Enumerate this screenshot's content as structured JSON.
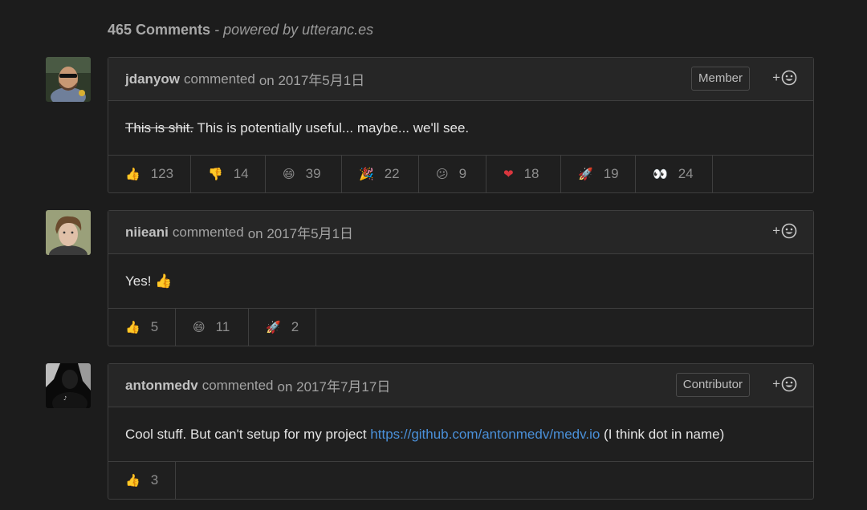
{
  "header": {
    "count_label": "465 Comments",
    "powered_label": "- powered by utteranc.es"
  },
  "comments": [
    {
      "author": "jdanyow",
      "verb": "commented",
      "date": "on 2017年5月1日",
      "badge": "Member",
      "body_strike": "This is shit.",
      "body_text": " This is potentially useful... maybe... we'll see.",
      "reactions": [
        {
          "icon": "thumbs-up-icon",
          "emoji": "👍",
          "count": "123"
        },
        {
          "icon": "thumbs-down-icon",
          "emoji": "👎",
          "count": "14"
        },
        {
          "icon": "laugh-icon",
          "emoji": "😄",
          "count": "39"
        },
        {
          "icon": "hooray-icon",
          "emoji": "🎉",
          "count": "22"
        },
        {
          "icon": "confused-icon",
          "emoji": "😕",
          "count": "9"
        },
        {
          "icon": "heart-icon",
          "emoji": "❤",
          "count": "18"
        },
        {
          "icon": "rocket-icon",
          "emoji": "🚀",
          "count": "19"
        },
        {
          "icon": "eyes-icon",
          "emoji": "👀",
          "count": "24"
        }
      ]
    },
    {
      "author": "niieani",
      "verb": "commented",
      "date": "on 2017年5月1日",
      "body_text": "Yes! 👍",
      "reactions": [
        {
          "icon": "thumbs-up-icon",
          "emoji": "👍",
          "count": "5"
        },
        {
          "icon": "laugh-icon",
          "emoji": "😄",
          "count": "11"
        },
        {
          "icon": "rocket-icon",
          "emoji": "🚀",
          "count": "2"
        }
      ]
    },
    {
      "author": "antonmedv",
      "verb": "commented",
      "date": "on 2017年7月17日",
      "badge": "Contributor",
      "body_text": "Cool stuff. But can't setup for my project ",
      "body_link": "https://github.com/antonmedv/medv.io",
      "body_after": " (I think dot in name)",
      "reactions": [
        {
          "icon": "thumbs-up-icon",
          "emoji": "👍",
          "count": "3"
        }
      ]
    }
  ],
  "add_reaction_label": "+"
}
